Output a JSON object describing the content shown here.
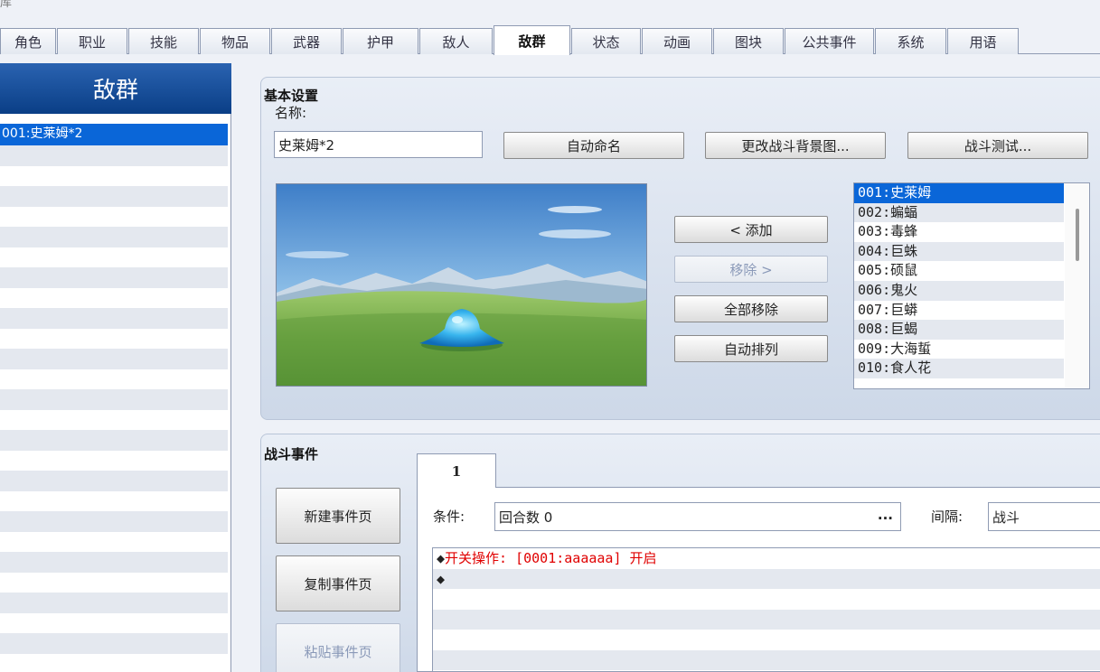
{
  "window_title": "库",
  "tabs": [
    "角色",
    "职业",
    "技能",
    "物品",
    "武器",
    "护甲",
    "敌人",
    "敌群",
    "状态",
    "动画",
    "图块",
    "公共事件",
    "系统",
    "用语"
  ],
  "active_tab": "敌群",
  "left_panel": {
    "header": "敌群",
    "items": [
      "001:史莱姆*2"
    ]
  },
  "basic": {
    "title": "基本设置",
    "name_label": "名称:",
    "name_value": "史莱姆*2",
    "auto_name": "自动命名",
    "change_bg": "更改战斗背景图...",
    "battle_test": "战斗测试...",
    "add": "< 添加",
    "remove": "移除 >",
    "remove_all": "全部移除",
    "arrange": "自动排列"
  },
  "enemies": [
    "001:史莱姆",
    "002:蝙蝠",
    "003:毒蜂",
    "004:巨蛛",
    "005:硕鼠",
    "006:鬼火",
    "007:巨蟒",
    "008:巨蝎",
    "009:大海蜇",
    "010:食人花"
  ],
  "battle_event": {
    "title": "战斗事件",
    "new_page": "新建事件页",
    "copy_page": "复制事件页",
    "paste_page": "粘贴事件页",
    "page_tab": "1",
    "condition_label": "条件:",
    "condition_value": "回合数 0",
    "condition_dots": "...",
    "span_label": "间隔:",
    "span_value": "战斗",
    "commands": [
      {
        "bullet": "◆",
        "text": "开关操作: [0001:aaaaaa] 开启"
      },
      {
        "bullet": "◆",
        "text": ""
      }
    ]
  }
}
